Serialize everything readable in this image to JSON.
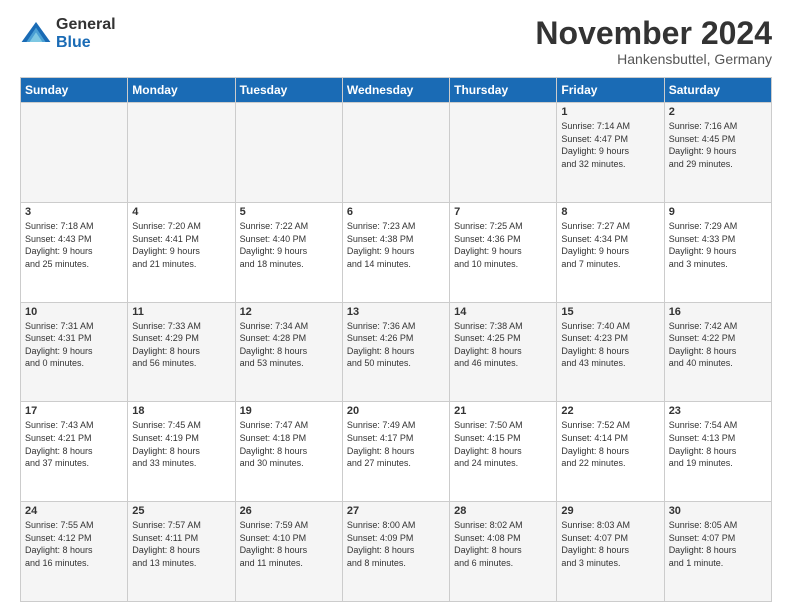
{
  "logo": {
    "general": "General",
    "blue": "Blue"
  },
  "title": "November 2024",
  "location": "Hankensbuttel, Germany",
  "days_header": [
    "Sunday",
    "Monday",
    "Tuesday",
    "Wednesday",
    "Thursday",
    "Friday",
    "Saturday"
  ],
  "weeks": [
    [
      {
        "day": "",
        "info": ""
      },
      {
        "day": "",
        "info": ""
      },
      {
        "day": "",
        "info": ""
      },
      {
        "day": "",
        "info": ""
      },
      {
        "day": "",
        "info": ""
      },
      {
        "day": "1",
        "info": "Sunrise: 7:14 AM\nSunset: 4:47 PM\nDaylight: 9 hours\nand 32 minutes."
      },
      {
        "day": "2",
        "info": "Sunrise: 7:16 AM\nSunset: 4:45 PM\nDaylight: 9 hours\nand 29 minutes."
      }
    ],
    [
      {
        "day": "3",
        "info": "Sunrise: 7:18 AM\nSunset: 4:43 PM\nDaylight: 9 hours\nand 25 minutes."
      },
      {
        "day": "4",
        "info": "Sunrise: 7:20 AM\nSunset: 4:41 PM\nDaylight: 9 hours\nand 21 minutes."
      },
      {
        "day": "5",
        "info": "Sunrise: 7:22 AM\nSunset: 4:40 PM\nDaylight: 9 hours\nand 18 minutes."
      },
      {
        "day": "6",
        "info": "Sunrise: 7:23 AM\nSunset: 4:38 PM\nDaylight: 9 hours\nand 14 minutes."
      },
      {
        "day": "7",
        "info": "Sunrise: 7:25 AM\nSunset: 4:36 PM\nDaylight: 9 hours\nand 10 minutes."
      },
      {
        "day": "8",
        "info": "Sunrise: 7:27 AM\nSunset: 4:34 PM\nDaylight: 9 hours\nand 7 minutes."
      },
      {
        "day": "9",
        "info": "Sunrise: 7:29 AM\nSunset: 4:33 PM\nDaylight: 9 hours\nand 3 minutes."
      }
    ],
    [
      {
        "day": "10",
        "info": "Sunrise: 7:31 AM\nSunset: 4:31 PM\nDaylight: 9 hours\nand 0 minutes."
      },
      {
        "day": "11",
        "info": "Sunrise: 7:33 AM\nSunset: 4:29 PM\nDaylight: 8 hours\nand 56 minutes."
      },
      {
        "day": "12",
        "info": "Sunrise: 7:34 AM\nSunset: 4:28 PM\nDaylight: 8 hours\nand 53 minutes."
      },
      {
        "day": "13",
        "info": "Sunrise: 7:36 AM\nSunset: 4:26 PM\nDaylight: 8 hours\nand 50 minutes."
      },
      {
        "day": "14",
        "info": "Sunrise: 7:38 AM\nSunset: 4:25 PM\nDaylight: 8 hours\nand 46 minutes."
      },
      {
        "day": "15",
        "info": "Sunrise: 7:40 AM\nSunset: 4:23 PM\nDaylight: 8 hours\nand 43 minutes."
      },
      {
        "day": "16",
        "info": "Sunrise: 7:42 AM\nSunset: 4:22 PM\nDaylight: 8 hours\nand 40 minutes."
      }
    ],
    [
      {
        "day": "17",
        "info": "Sunrise: 7:43 AM\nSunset: 4:21 PM\nDaylight: 8 hours\nand 37 minutes."
      },
      {
        "day": "18",
        "info": "Sunrise: 7:45 AM\nSunset: 4:19 PM\nDaylight: 8 hours\nand 33 minutes."
      },
      {
        "day": "19",
        "info": "Sunrise: 7:47 AM\nSunset: 4:18 PM\nDaylight: 8 hours\nand 30 minutes."
      },
      {
        "day": "20",
        "info": "Sunrise: 7:49 AM\nSunset: 4:17 PM\nDaylight: 8 hours\nand 27 minutes."
      },
      {
        "day": "21",
        "info": "Sunrise: 7:50 AM\nSunset: 4:15 PM\nDaylight: 8 hours\nand 24 minutes."
      },
      {
        "day": "22",
        "info": "Sunrise: 7:52 AM\nSunset: 4:14 PM\nDaylight: 8 hours\nand 22 minutes."
      },
      {
        "day": "23",
        "info": "Sunrise: 7:54 AM\nSunset: 4:13 PM\nDaylight: 8 hours\nand 19 minutes."
      }
    ],
    [
      {
        "day": "24",
        "info": "Sunrise: 7:55 AM\nSunset: 4:12 PM\nDaylight: 8 hours\nand 16 minutes."
      },
      {
        "day": "25",
        "info": "Sunrise: 7:57 AM\nSunset: 4:11 PM\nDaylight: 8 hours\nand 13 minutes."
      },
      {
        "day": "26",
        "info": "Sunrise: 7:59 AM\nSunset: 4:10 PM\nDaylight: 8 hours\nand 11 minutes."
      },
      {
        "day": "27",
        "info": "Sunrise: 8:00 AM\nSunset: 4:09 PM\nDaylight: 8 hours\nand 8 minutes."
      },
      {
        "day": "28",
        "info": "Sunrise: 8:02 AM\nSunset: 4:08 PM\nDaylight: 8 hours\nand 6 minutes."
      },
      {
        "day": "29",
        "info": "Sunrise: 8:03 AM\nSunset: 4:07 PM\nDaylight: 8 hours\nand 3 minutes."
      },
      {
        "day": "30",
        "info": "Sunrise: 8:05 AM\nSunset: 4:07 PM\nDaylight: 8 hours\nand 1 minute."
      }
    ]
  ]
}
